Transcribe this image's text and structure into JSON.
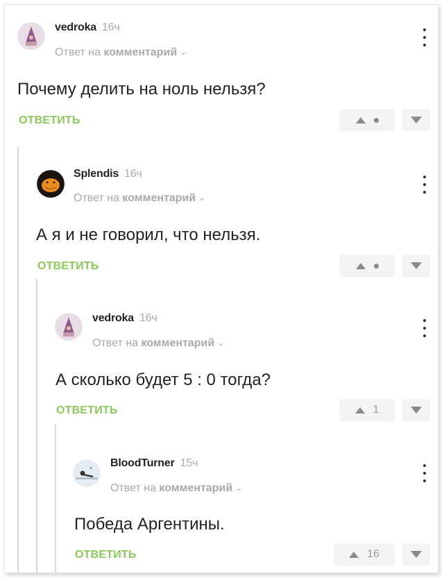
{
  "comments": [
    {
      "username": "vedroka",
      "time": "16ч",
      "reply_prefix": "Ответ на",
      "reply_target": "комментарий",
      "text": "Почему делить на ноль нельзя?",
      "reply_label": "ОТВЕТИТЬ",
      "rating": "",
      "avatar": "gnome-hat-avatar"
    },
    {
      "username": "Splendis",
      "time": "16ч",
      "reply_prefix": "Ответ на",
      "reply_target": "комментарий",
      "text": "А я и не говорил, что нельзя.",
      "reply_label": "ОТВЕТИТЬ",
      "rating": "",
      "avatar": "pumpkin-avatar"
    },
    {
      "username": "vedroka",
      "time": "16ч",
      "reply_prefix": "Ответ на",
      "reply_target": "комментарий",
      "text": "А сколько будет 5 : 0 тогда?",
      "reply_label": "ОТВЕТИТЬ",
      "rating": "1",
      "avatar": "gnome-hat-avatar"
    },
    {
      "username": "BloodTurner",
      "time": "15ч",
      "reply_prefix": "Ответ на",
      "reply_target": "комментарий",
      "text": "Победа Аргентины.",
      "reply_label": "ОТВЕТИТЬ",
      "rating": "16",
      "avatar": "person-lying-avatar"
    }
  ],
  "colors": {
    "accent_green": "#8ac858",
    "muted_text": "#a9a9a9",
    "vote_bg": "#f3f3f3"
  },
  "icons": [
    "kebab-menu-icon",
    "upvote-icon",
    "downvote-icon",
    "chevron-down-icon"
  ]
}
